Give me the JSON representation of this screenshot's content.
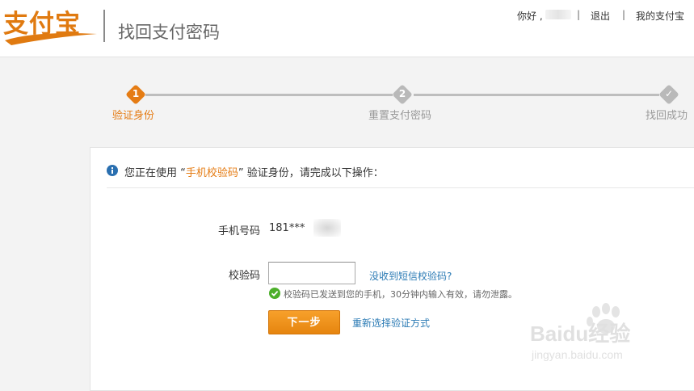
{
  "header": {
    "logo_text": "支付宝",
    "page_title": "找回支付密码",
    "greeting": "你好 ,",
    "separator": "|",
    "logout_label": "退出",
    "my_alipay_label": "我的支付宝"
  },
  "steps": [
    {
      "number": "1",
      "label": "验证身份",
      "state": "active"
    },
    {
      "number": "2",
      "label": "重置支付密码",
      "state": "idle"
    },
    {
      "number": "✓",
      "label": "找回成功",
      "state": "idle"
    }
  ],
  "notice": {
    "prefix": "您正在使用 “",
    "method": "手机校验码",
    "suffix": "” 验证身份，请完成以下操作："
  },
  "form": {
    "phone_label": "手机号码",
    "phone_value": "181***",
    "code_label": "校验码",
    "code_value": "",
    "no_sms_link": "没收到短信校验码?",
    "sent_tip": "校验码已发送到您的手机，30分钟内输入有效，请勿泄露。",
    "next_button": "下一步",
    "reselect_link": "重新选择验证方式"
  },
  "watermark": {
    "brand": "Baidu经验",
    "url": "jingyan.baidu.com"
  },
  "colors": {
    "accent_orange": "#e57c14",
    "link_blue": "#2a7ab4",
    "step_idle_gray": "#b9b9b9"
  },
  "icons": {
    "info": "info-circle-icon",
    "success": "check-circle-icon"
  }
}
